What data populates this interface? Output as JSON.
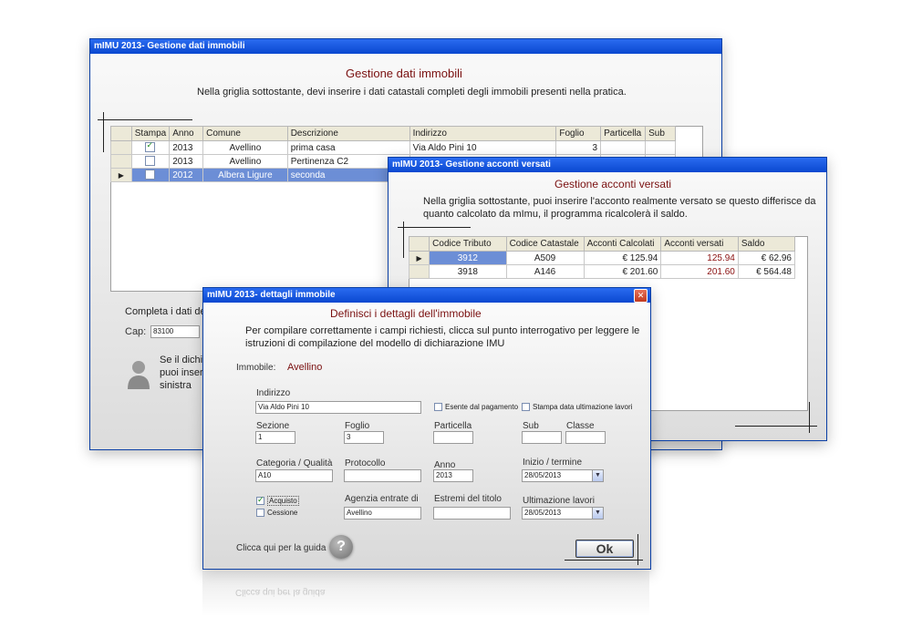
{
  "win_immobili": {
    "title": "mIMU 2013- Gestione dati immobili",
    "heading": "Gestione dati immobili",
    "subtitle": "Nella griglia sottostante, devi inserire i dati catastali completi degli immobili presenti nella pratica.",
    "grid": {
      "columns": [
        "Stampa",
        "Anno",
        "Comune",
        "Descrizione",
        "Indirizzo",
        "Foglio",
        "Particella",
        "Sub"
      ],
      "rows": [
        {
          "stampa": true,
          "anno": "2013",
          "comune": "Avellino",
          "descrizione": "prima casa",
          "indirizzo": "Via Aldo Pini 10",
          "foglio": "3",
          "particella": "",
          "sub": ""
        },
        {
          "stampa": false,
          "anno": "2013",
          "comune": "Avellino",
          "descrizione": "Pertinenza C2",
          "indirizzo": "",
          "foglio": "",
          "particella": "",
          "sub": ""
        },
        {
          "stampa": false,
          "anno": "2012",
          "comune": "Albera Ligure",
          "descrizione": "seconda",
          "indirizzo": "",
          "foglio": "",
          "particella": "",
          "sub": ""
        }
      ]
    },
    "completa_label": "Completa i dati de",
    "cap_label": "Cap:",
    "cap_value": "83100",
    "hint_line1": "Se il dichi",
    "hint_line2": "puoi inser",
    "hint_line3": "sinistra"
  },
  "win_acconti": {
    "title": "mIMU 2013- Gestione acconti versati",
    "heading": "Gestione acconti versati",
    "subtitle_line1": "Nella griglia sottostante, puoi inserire l'acconto realmente versato se questo differisce da",
    "subtitle_line2": "quanto calcolato da mImu, il programma ricalcolerà il saldo.",
    "grid": {
      "columns": [
        "Codice Tributo",
        "Codice Catastale",
        "Acconti Calcolati",
        "Acconti versati",
        "Saldo"
      ],
      "rows": [
        {
          "tributo": "3912",
          "catastale": "A509",
          "calcolati": "€ 125.94",
          "versati": "125.94",
          "saldo": "€ 62.96"
        },
        {
          "tributo": "3918",
          "catastale": "A146",
          "calcolati": "€ 201.60",
          "versati": "201.60",
          "saldo": "€ 564.48"
        }
      ]
    }
  },
  "win_dettagli": {
    "title": "mIMU 2013- dettagli immobile",
    "heading": "Definisci i dettagli dell'immobile",
    "subtitle_line1": "Per compilare correttamente i campi richiesti, clicca sul punto interrogativo per leggere le",
    "subtitle_line2": "istruzioni di compilazione del modello di dichiarazione IMU",
    "immobile_label": "Immobile:",
    "immobile_value": "Avellino",
    "indirizzo_label": "Indirizzo",
    "indirizzo_value": "Via Aldo Pini 10",
    "esente_label": "Esente dal pagamento",
    "stampa_data_label": "Stampa data ultimazione lavori",
    "sezione_label": "Sezione",
    "sezione_value": "1",
    "foglio_label": "Foglio",
    "foglio_value": "3",
    "particella_label": "Particella",
    "particella_value": "",
    "sub_label": "Sub",
    "classe_label": "Classe",
    "categoria_label": "Categoria / Qualità",
    "categoria_value": "A10",
    "protocollo_label": "Protocollo",
    "anno_label": "Anno",
    "anno_value": "2013",
    "inizio_label": "Inizio / termine",
    "inizio_value": "28/05/2013",
    "acquisto_label": "Acquisto",
    "cessione_label": "Cessione",
    "agenzia_label": "Agenzia entrate di",
    "agenzia_value": "Avellino",
    "estremi_label": "Estremi del titolo",
    "ultimazione_label": "Ultimazione lavori",
    "ultimazione_value": "28/05/2013",
    "guida_label": "Clicca qui per la guida",
    "help_glyph": "?",
    "ok_label": "Ok",
    "close_glyph": "✕",
    "reflection_text": "Clicca qui per la guida"
  },
  "colors": {
    "titlebar": "#0a48d0",
    "heading": "#7a1010",
    "selection": "#6c8ed6"
  }
}
